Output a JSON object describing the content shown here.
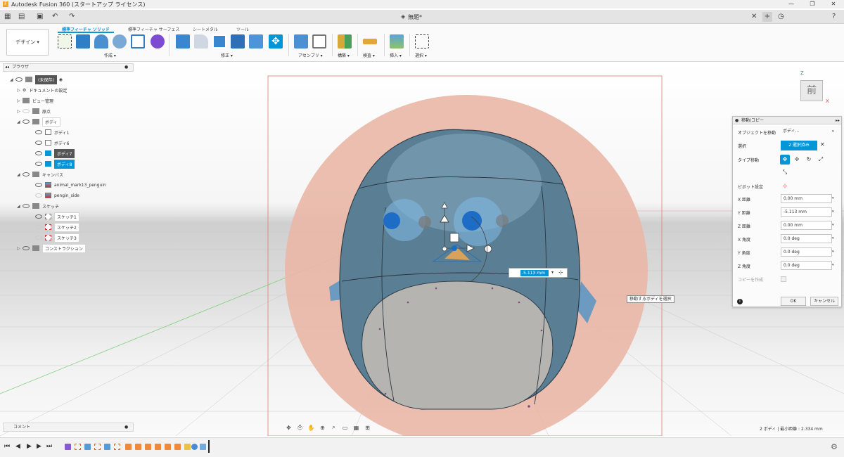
{
  "window": {
    "title": "Autodesk Fusion 360 (スタートアップ ライセンス)",
    "document_title": "無題*",
    "minimize": "—",
    "maximize": "❐",
    "close": "✕"
  },
  "toolbar": {
    "workspace_button": "デザイン ▾",
    "subtabs": [
      "標準フィーチャ ソリッド",
      "標準フィーチャ サーフェス",
      "シートメタル",
      "ツール"
    ],
    "groups": [
      "作成 ▾",
      "修正 ▾",
      "アセンブリ ▾",
      "構築 ▾",
      "検査 ▾",
      "挿入 ▾",
      "選択 ▾"
    ]
  },
  "browser": {
    "header": "ブラウザ",
    "root": "(未保存)",
    "items": [
      {
        "label": "ドキュメントの設定",
        "indent": 1
      },
      {
        "label": "ビュー管理",
        "indent": 1
      },
      {
        "label": "原点",
        "indent": 1
      },
      {
        "label": "ボディ",
        "indent": 1
      },
      {
        "label": "ボディ1",
        "indent": 2
      },
      {
        "label": "ボディ6",
        "indent": 2
      },
      {
        "label": "ボディ7",
        "indent": 2
      },
      {
        "label": "ボディ8",
        "indent": 2
      },
      {
        "label": "キャンバス",
        "indent": 1
      },
      {
        "label": "animal_mark13_penguin",
        "indent": 2
      },
      {
        "label": "pengin_side",
        "indent": 2
      },
      {
        "label": "スケッチ",
        "indent": 1
      },
      {
        "label": "スケッチ1",
        "indent": 2
      },
      {
        "label": "スケッチ2",
        "indent": 2
      },
      {
        "label": "スケッチ3",
        "indent": 2
      },
      {
        "label": "コンストラクション",
        "indent": 1
      }
    ]
  },
  "comments": {
    "label": "コメント"
  },
  "viewcube": {
    "face": "前",
    "z": "Z",
    "x": "X"
  },
  "dialog": {
    "title": "移動/コピー",
    "object_label": "オブジェクトを移動",
    "object_value": "ボディ...",
    "selection_label": "選択",
    "selection_value": "2 選択済み",
    "type_label": "タイプ移動",
    "pivot_label": "ピボット設定",
    "x_dist_label": "X 距離",
    "x_dist": "0.00 mm",
    "y_dist_label": "Y 距離",
    "y_dist": "-5.113 mm",
    "z_dist_label": "Z 距離",
    "z_dist": "0.00 mm",
    "x_angle_label": "X 角度",
    "x_angle": "0.0 deg",
    "y_angle_label": "Y 角度",
    "y_angle": "0.0 deg",
    "z_angle_label": "Z 角度",
    "z_angle": "0.0 deg",
    "copy_label": "コピーを作成",
    "ok": "OK",
    "cancel": "キャンセル"
  },
  "viewport": {
    "value_input": "-5.113 mm",
    "tooltip": "移動するボディを選択",
    "status": "2 ボディ | 最小距離 : 2.334 mm"
  },
  "colors": {
    "accent": "#0696d7",
    "body": "#5a7f95",
    "canvas_image": "#e9b7a6"
  }
}
